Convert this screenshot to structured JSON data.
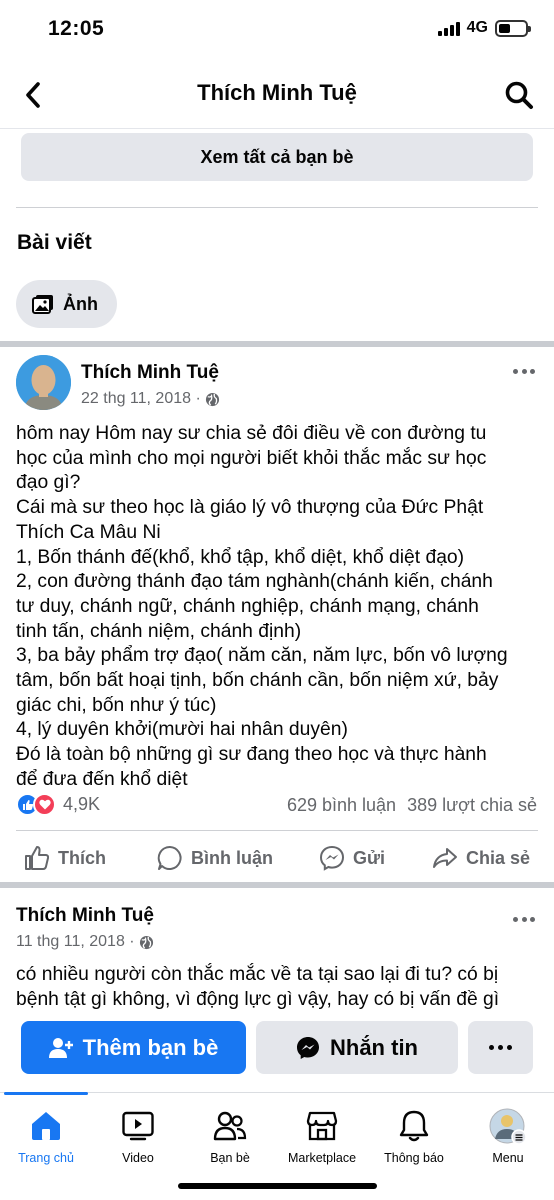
{
  "status": {
    "time": "12:05",
    "network": "4G"
  },
  "header": {
    "title": "Thích Minh Tuệ"
  },
  "friends": {
    "see_all_label": "Xem tất cả bạn bè"
  },
  "posts_section": {
    "title": "Bài viết",
    "photos_chip": "Ảnh"
  },
  "post1": {
    "author": "Thích Minh Tuệ",
    "date": "22 thg 11, 2018 ·",
    "lines": [
      "hôm nay Hôm nay sư chia sẻ đôi điều về con đường tu",
      "học của mình cho mọi người biết khỏi thắc mắc sư học",
      "đạo gì?",
      "Cái mà sư theo học là giáo lý vô thượng của Đức Phật",
      "Thích Ca Mâu Ni",
      "1, Bốn thánh đế(khổ, khổ tập, khổ diệt, khổ diệt đạo)",
      "2, con đường thánh đạo tám nghành(chánh kiến, chánh",
      "tư duy, chánh ngữ, chánh nghiệp, chánh mạng, chánh",
      "tinh tấn, chánh niệm, chánh định)",
      "3, ba bảy phẩm trợ đạo( năm căn, năm lực, bốn vô lượng",
      "tâm, bốn bất hoại tịnh, bốn chánh cần, bốn niệm xứ, bảy",
      "giác chi, bốn như ý túc)",
      "4, lý duyên khởi(mười hai nhân duyên)",
      "Đó là toàn bộ những gì sư đang theo học và thực hành",
      "để đưa đến khổ diệt"
    ],
    "reactions_count": "4,9K",
    "comments": "629 bình luận",
    "shares": "389 lượt chia sẻ",
    "actions": {
      "like": "Thích",
      "comment": "Bình luận",
      "send": "Gửi",
      "share": "Chia sẻ"
    }
  },
  "post2": {
    "author": "Thích Minh Tuệ",
    "date": "11 thg 11, 2018 ·",
    "lines": [
      "có nhiều người còn thắc mắc về ta tại sao lại đi tu? có bị",
      "bệnh tật gì không, vì động lực gì vậy, hay có bị vấn đề gì"
    ]
  },
  "cta": {
    "add_friend": "Thêm bạn bè",
    "message": "Nhắn tin"
  },
  "tabbar": {
    "home": "Trang chủ",
    "video": "Video",
    "friends": "Bạn bè",
    "marketplace": "Marketplace",
    "notifications": "Thông báo",
    "menu": "Menu"
  },
  "colors": {
    "accent": "#1877f2",
    "love": "#f33e58",
    "muted": "#65676b",
    "surface": "#e4e6eb"
  }
}
